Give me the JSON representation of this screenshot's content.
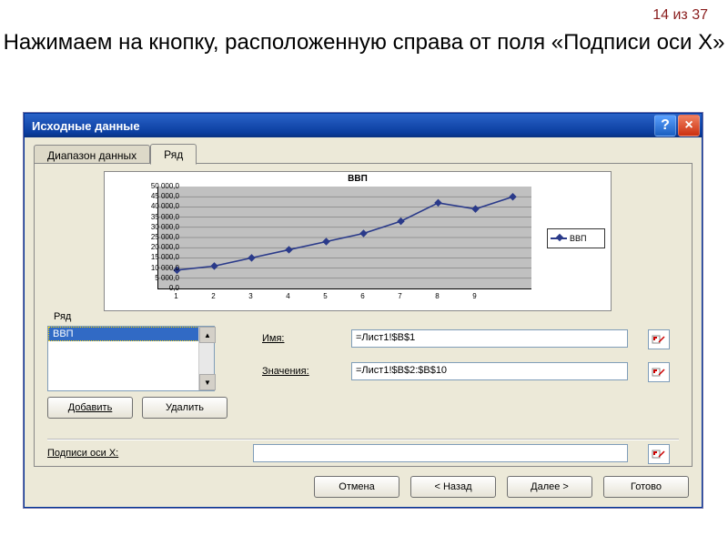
{
  "page_number": "14 из 37",
  "heading": "Нажимаем на кнопку, расположенную справа от поля «Подписи оси Х»",
  "dialog": {
    "title": "Исходные данные",
    "help_label": "?",
    "close_label": "×",
    "tabs": {
      "data_range": "Диапазон данных",
      "series": "Ряд"
    },
    "series_group_label": "Ряд",
    "series_items": [
      "ВВП"
    ],
    "add_label": "Добавить",
    "remove_label": "Удалить",
    "name_label": "Имя:",
    "name_value": "=Лист1!$B$1",
    "values_label": "Значения:",
    "values_value": "=Лист1!$B$2:$B$10",
    "xlabels_label": "Подписи оси X:",
    "xlabels_value": "",
    "btn_cancel": "Отмена",
    "btn_back": "< Назад",
    "btn_next": "Далее >",
    "btn_finish": "Готово"
  },
  "chart_data": {
    "type": "line",
    "title": "ВВП",
    "legend": "ВВП",
    "categories": [
      "1",
      "2",
      "3",
      "4",
      "5",
      "6",
      "7",
      "8",
      "9"
    ],
    "yticks": [
      "0,0",
      "5 000,0",
      "10 000,0",
      "15 000,0",
      "20 000,0",
      "25 000,0",
      "30 000,0",
      "35 000,0",
      "40 000,0",
      "45 000,0",
      "50 000,0"
    ],
    "ymax": 50000,
    "values": [
      9000,
      11000,
      15000,
      19000,
      23000,
      27000,
      33000,
      42000,
      39000,
      45000
    ]
  }
}
